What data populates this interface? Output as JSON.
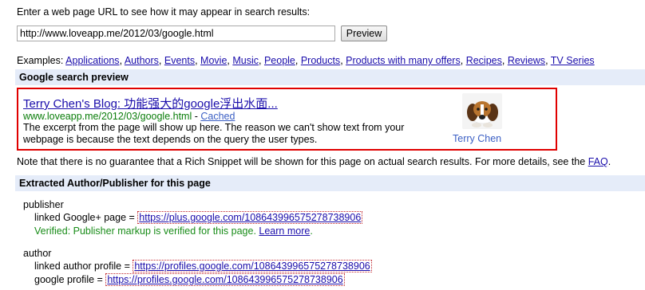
{
  "intro": "Enter a web page URL to see how it may appear in search results:",
  "form": {
    "url_value": "http://www.loveapp.me/2012/03/google.html",
    "preview_button": "Preview"
  },
  "examples": {
    "label": "Examples:",
    "links": [
      "Applications",
      "Authors",
      "Events",
      "Movie",
      "Music",
      "People",
      "Products",
      "Products with many offers",
      "Recipes",
      "Reviews",
      "TV Series"
    ]
  },
  "preview_section": {
    "header": "Google search preview",
    "title": "Terry Chen's Blog: 功能强大的google浮出水面...",
    "url": "www.loveapp.me/2012/03/google.html",
    "separator": " - ",
    "cached": "Cached",
    "snippet": "The excerpt from the page will show up here. The reason we can't show text from your webpage is because the text depends on the query the user types.",
    "author_name": "Terry Chen"
  },
  "note": {
    "text": "Note that there is no guarantee that a Rich Snippet will be shown for this page on actual search results. For more details, see the ",
    "link": "FAQ",
    "end": "."
  },
  "extracted_section": {
    "header": "Extracted Author/Publisher for this page",
    "publisher": {
      "label": "publisher",
      "linked_label": "linked Google+ page = ",
      "linked_url": "https://plus.google.com/108643996575278738906",
      "verified_text": "Verified: Publisher markup is verified for this page.",
      "learn_more": "Learn more",
      "end": "."
    },
    "author": {
      "label": "author",
      "linked_label": "linked author profile = ",
      "linked_url": "https://profiles.google.com/108643996575278738906",
      "google_label": "google profile = ",
      "google_url": "https://profiles.google.com/108643996575278738906"
    }
  },
  "colors": {
    "section_header_bg": "#e5ecf9",
    "preview_border": "#e00000",
    "result_url": "#0a7d0a",
    "verified": "#188c18",
    "link": "#1a0dab"
  }
}
